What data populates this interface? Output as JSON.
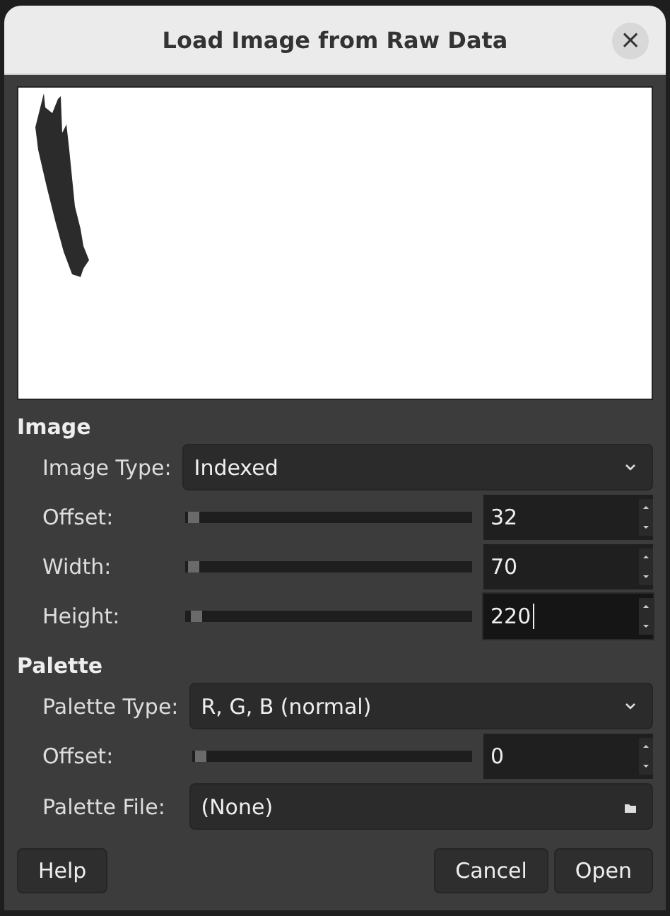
{
  "window": {
    "title": "Load Image from Raw Data",
    "close": "×"
  },
  "sections": [
    {
      "title": "Image",
      "rows": [
        {
          "kind": "dropdown",
          "label": "Image Type:",
          "value": "Indexed"
        },
        {
          "kind": "slider",
          "label": "Offset:",
          "value": "32",
          "level": 0.01,
          "focused": false
        },
        {
          "kind": "slider",
          "label": "Width:",
          "value": "70",
          "level": 0.01,
          "focused": false
        },
        {
          "kind": "slider",
          "label": "Height:",
          "value": "220",
          "level": 0.02,
          "focused": true
        }
      ]
    },
    {
      "title": "Palette",
      "rows": [
        {
          "kind": "dropdown",
          "label": "Palette Type:",
          "value": "R, G, B (normal)"
        },
        {
          "kind": "slider",
          "label": "Offset:",
          "value": "0",
          "level": 0.01,
          "focused": false
        },
        {
          "kind": "file",
          "label": "Palette File:",
          "value": "(None)"
        }
      ]
    }
  ],
  "buttons": [
    {
      "label": "Help"
    },
    {
      "label": "Cancel"
    },
    {
      "label": "Open"
    }
  ]
}
